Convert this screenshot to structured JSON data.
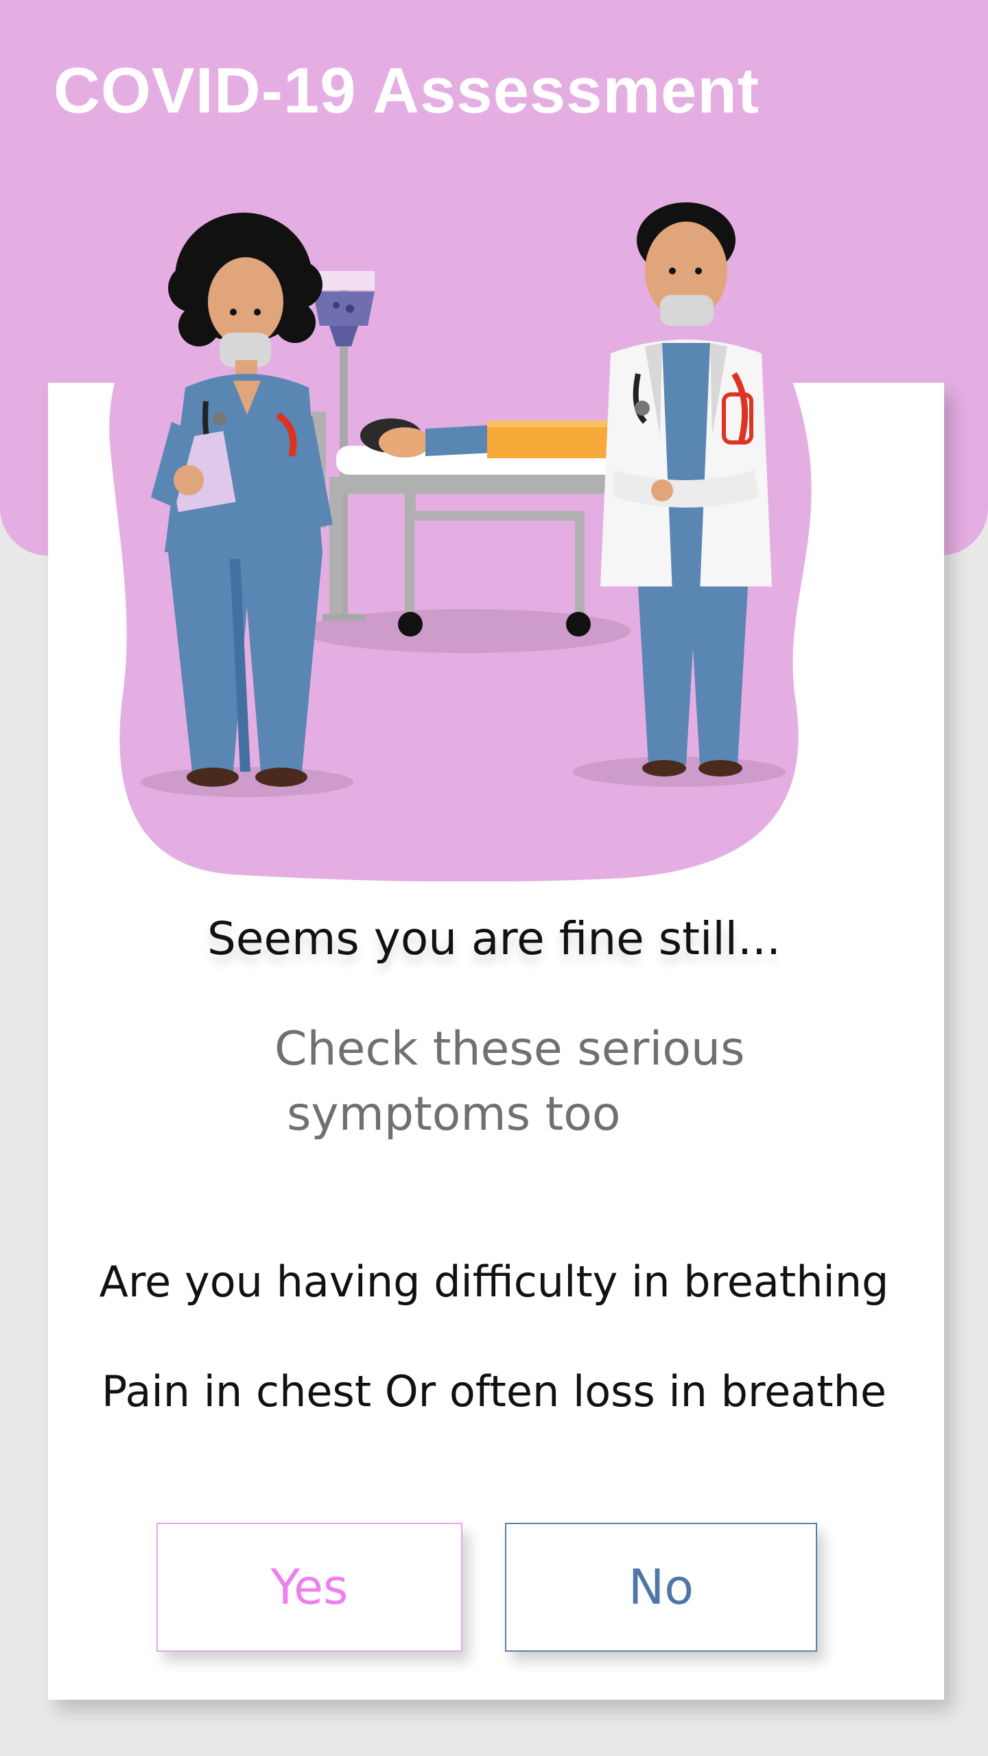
{
  "header": {
    "title": "COVID-19 Assessment"
  },
  "card": {
    "illustration": "doctors-with-patient-illustration",
    "headline": "Seems you are fine still...",
    "subtitle_line1": "Check these serious",
    "subtitle_line2": "symptoms too",
    "question_line1": "Are you having difficulty in breathing",
    "question_line2": "Pain in chest Or often loss in breathe"
  },
  "buttons": {
    "yes_label": "Yes",
    "no_label": "No"
  },
  "colors": {
    "header_bg": "#e4aee2",
    "page_bg": "#e8e8e8",
    "yes_text": "#ee7fee",
    "no_text": "#4f76a6"
  }
}
